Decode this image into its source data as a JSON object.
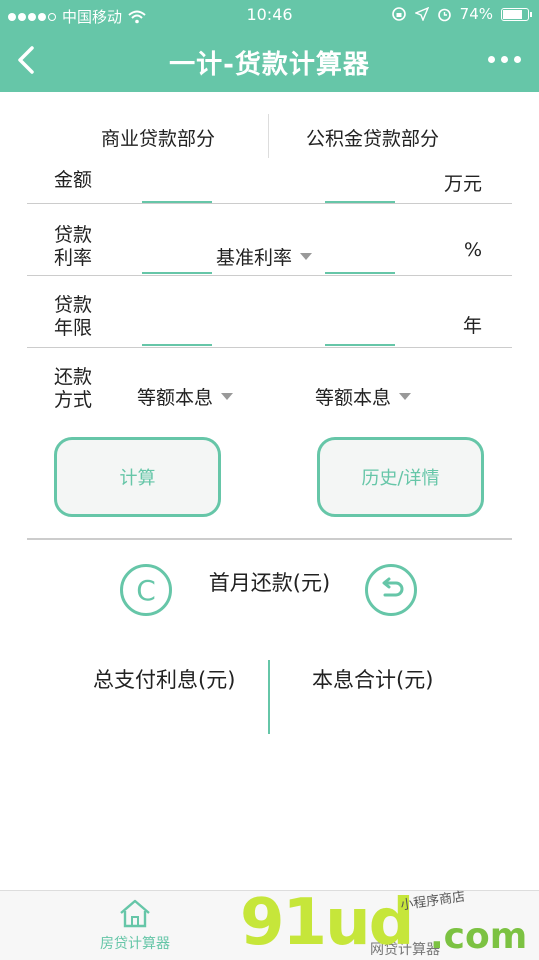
{
  "status_bar": {
    "carrier": "中国移动",
    "time": "10:46",
    "battery_percent": "74%",
    "battery_level": 0.74,
    "icons": [
      "signal-dots",
      "wifi-icon",
      "rotation-lock-icon",
      "location-arrow-icon",
      "alarm-icon",
      "battery-icon"
    ]
  },
  "nav": {
    "title": "一计-货款计算器",
    "back_icon": "chevron-left-icon",
    "more_icon": "more-dots-icon"
  },
  "tabs": {
    "commercial": "商业贷款部分",
    "provident": "公积金贷款部分"
  },
  "form": {
    "amount_label": "金额",
    "amount_unit": "万元",
    "rate_label_1": "贷款",
    "rate_label_2": "利率",
    "rate_select": "基准利率",
    "rate_unit": "%",
    "term_label_1": "贷款",
    "term_label_2": "年限",
    "term_unit": "年",
    "method_label_1": "还款",
    "method_label_2": "方式",
    "method_commercial": "等额本息",
    "method_provident": "等额本息"
  },
  "buttons": {
    "calculate": "计算",
    "history": "历史/详情"
  },
  "results": {
    "clear_icon_text": "C",
    "first_month": "首月还款(元)",
    "total_interest": "总支付利息(元)",
    "total_sum": "本息合计(元)"
  },
  "tabbar": {
    "home": "房贷计算器",
    "net": "网贷计算器"
  },
  "watermark": {
    "brand": "91ud",
    "domain": ".com",
    "small": "小程序商店"
  },
  "colors": {
    "accent": "#66c6a8",
    "watermark_green": "#c6e63a"
  }
}
